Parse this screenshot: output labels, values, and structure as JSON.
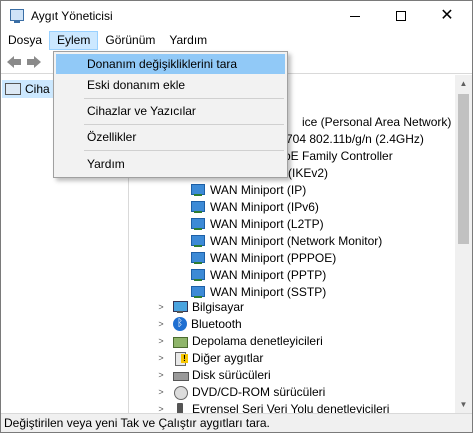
{
  "window": {
    "title": "Aygıt Yöneticisi",
    "controls": {
      "minimize": "—",
      "maximize": "□",
      "close": "✕"
    }
  },
  "menubar": {
    "items": [
      {
        "label": "Dosya"
      },
      {
        "label": "Eylem"
      },
      {
        "label": "Görünüm"
      },
      {
        "label": "Yardım"
      }
    ]
  },
  "toolbar": {
    "back_icon": "arrow-left-icon",
    "forward_icon": "arrow-right-icon"
  },
  "left_pane": {
    "selected_item": "Ciha"
  },
  "dropdown": {
    "items": [
      {
        "label": "Donanım değişikliklerini tara"
      },
      {
        "label": "Eski donanım ekle"
      },
      {
        "label": "Cihazlar ve Yazıcılar"
      },
      {
        "label": "Özellikler"
      },
      {
        "label": "Yardım"
      }
    ]
  },
  "tree": {
    "partial_rows": [
      {
        "label": "ice (Personal Area Network)"
      },
      {
        "label": "704 802.11b/g/n (2.4GHz)"
      },
      {
        "label": "bE Family Controller"
      },
      {
        "label": "(IKEv2)"
      }
    ],
    "network_rows": [
      {
        "label": "WAN Miniport (IP)"
      },
      {
        "label": "WAN Miniport (IPv6)"
      },
      {
        "label": "WAN Miniport (L2TP)"
      },
      {
        "label": "WAN Miniport (Network Monitor)"
      },
      {
        "label": "WAN Miniport (PPPOE)"
      },
      {
        "label": "WAN Miniport (PPTP)"
      },
      {
        "label": "WAN Miniport (SSTP)"
      }
    ],
    "categories": [
      {
        "label": "Bilgisayar",
        "icon": "computer-icon"
      },
      {
        "label": "Bluetooth",
        "icon": "bluetooth-icon"
      },
      {
        "label": "Depolama denetleyicileri",
        "icon": "storage-icon"
      },
      {
        "label": "Diğer aygıtlar",
        "icon": "unknown-device-icon"
      },
      {
        "label": "Disk sürücüleri",
        "icon": "disk-icon"
      },
      {
        "label": "DVD/CD-ROM sürücüleri",
        "icon": "dvd-icon"
      },
      {
        "label": "Evrensel Seri Veri Yolu denetleyicileri",
        "icon": "usb-icon"
      }
    ]
  },
  "statusbar": {
    "text": "Değiştirilen veya yeni Tak ve Çalıştır aygıtları tara."
  }
}
